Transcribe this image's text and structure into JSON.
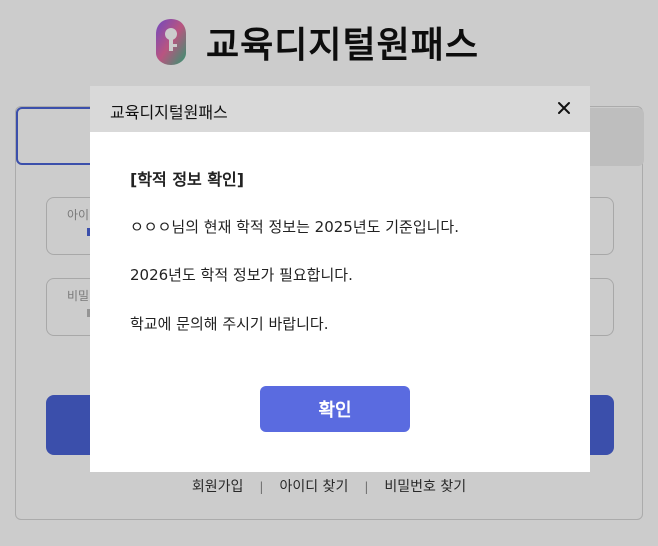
{
  "brand": {
    "logo_text": "교육디지털원패스"
  },
  "login_form": {
    "id_field_label": "아이디",
    "password_field_label": "비밀번호"
  },
  "footer_links": {
    "signup": "회원가입",
    "find_id": "아이디 찾기",
    "find_password": "비밀번호 찾기",
    "separator": "|"
  },
  "modal": {
    "title": "교육디지털원패스",
    "heading": "[학적 정보 확인]",
    "line1": "ㅇㅇㅇ님의 현재 학적 정보는 2025년도 기준입니다.",
    "line2": "2026년도 학적 정보가 필요합니다.",
    "line3": "학교에 문의해 주시기 바랍니다.",
    "confirm_label": "확인",
    "close_icon": "close-icon"
  },
  "colors": {
    "accent": "#4a63d6",
    "confirm_button": "#5a6be0",
    "modal_header": "#d9d9d9"
  }
}
